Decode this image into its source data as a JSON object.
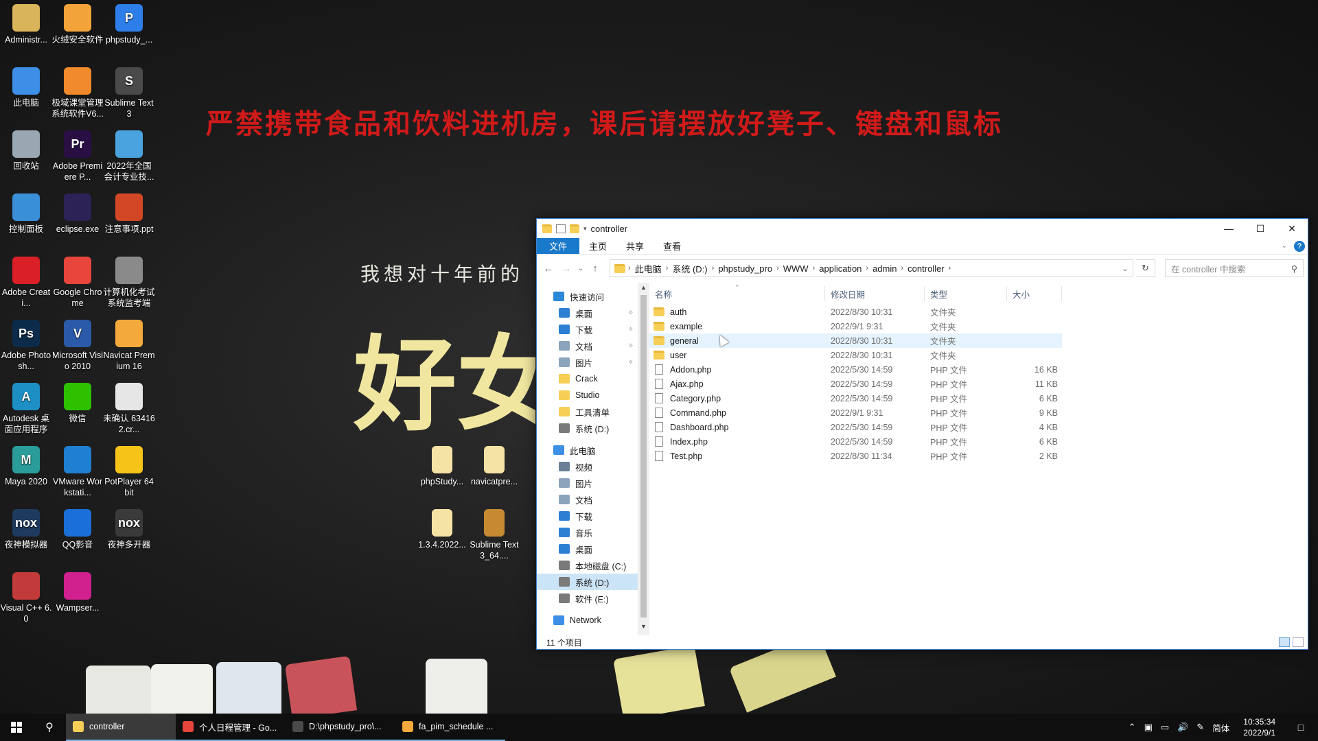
{
  "wallpaper": {
    "banner": "严禁携带食品和饮料进机房，课后请摆放好凳子、键盘和鼠标",
    "phrase": "我想对十年前的",
    "big_text": "好女"
  },
  "desktop_icons": [
    {
      "label": "Administr...",
      "icon": "user-folder-icon",
      "color": "#d9b45a"
    },
    {
      "label": "火绒安全软件",
      "icon": "huorong-icon",
      "color": "#f2a33a"
    },
    {
      "label": "phpstudy_...",
      "icon": "phpstudy-icon",
      "color": "#2d7ee8",
      "glyph": "P"
    },
    {
      "label": "此电脑",
      "icon": "computer-icon",
      "color": "#3c8ee6"
    },
    {
      "label": "极域课堂管理系统软件V6...",
      "icon": "classroom-icon",
      "color": "#f08a2c"
    },
    {
      "label": "Sublime Text3",
      "icon": "sublime-icon",
      "color": "#4a4a4a",
      "glyph": "S"
    },
    {
      "label": "回收站",
      "icon": "recycle-bin-icon",
      "color": "#9aa7b3"
    },
    {
      "label": "Adobe Premiere P...",
      "icon": "premiere-icon",
      "color": "#2a0f45",
      "glyph": "Pr"
    },
    {
      "label": "2022年全国会计专业技...",
      "icon": "mp3-file-icon",
      "color": "#4aa3df"
    },
    {
      "label": "控制面板",
      "icon": "control-panel-icon",
      "color": "#3a8fd9"
    },
    {
      "label": "eclipse.exe",
      "icon": "eclipse-icon",
      "color": "#2c2255"
    },
    {
      "label": "注意事项.ppt",
      "icon": "ppt-file-icon",
      "color": "#d24726"
    },
    {
      "label": "Adobe Creati...",
      "icon": "creative-cloud-icon",
      "color": "#da1f26"
    },
    {
      "label": "Google Chrome",
      "icon": "chrome-icon",
      "color": "#e8453c"
    },
    {
      "label": "计算机化考试系统监考端",
      "icon": "exam-icon",
      "color": "#8a8a8a"
    },
    {
      "label": "Adobe Photosh...",
      "icon": "photoshop-icon",
      "color": "#0c2b4a",
      "glyph": "Ps"
    },
    {
      "label": "Microsoft Visio 2010",
      "icon": "visio-icon",
      "color": "#2a5aa8",
      "glyph": "V"
    },
    {
      "label": "Navicat Premium 16",
      "icon": "navicat-icon",
      "color": "#f3a93b"
    },
    {
      "label": "Autodesk 桌面应用程序",
      "icon": "autodesk-icon",
      "color": "#1d8fc4",
      "glyph": "A"
    },
    {
      "label": "微信",
      "icon": "wechat-icon",
      "color": "#2dc100"
    },
    {
      "label": "未确认 634162.cr...",
      "icon": "file-icon",
      "color": "#e6e6e6"
    },
    {
      "label": "Maya 2020",
      "icon": "maya-icon",
      "color": "#2a9d9a",
      "glyph": "M"
    },
    {
      "label": "VMware Workstati...",
      "icon": "vmware-icon",
      "color": "#1f7fd1"
    },
    {
      "label": "PotPlayer 64 bit",
      "icon": "potplayer-icon",
      "color": "#f6c419"
    },
    {
      "label": "夜神模拟器",
      "icon": "nox-icon",
      "color": "#1e3a5f",
      "glyph": "nox"
    },
    {
      "label": "QQ影音",
      "icon": "qqplayer-icon",
      "color": "#1a6fd8"
    },
    {
      "label": "夜神多开器",
      "icon": "nox-multi-icon",
      "color": "#3a3a3a",
      "glyph": "nox"
    },
    {
      "label": "Visual C++ 6.0",
      "icon": "visual-cpp-icon",
      "color": "#c23a3a"
    },
    {
      "label": "Wampser...",
      "icon": "wampserver-icon",
      "color": "#d0218f"
    }
  ],
  "desktop_files": [
    {
      "label": "phpStudy...",
      "icon": "folder-icon"
    },
    {
      "label": "navicatpre...",
      "icon": "folder-icon"
    },
    {
      "label": "1.3.4.2022...",
      "icon": "folder-icon"
    },
    {
      "label": "Sublime Text3_64....",
      "icon": "archive-icon"
    }
  ],
  "explorer": {
    "title": "controller",
    "ribbon_tabs": [
      "文件",
      "主页",
      "共享",
      "查看"
    ],
    "help": "?",
    "breadcrumb": [
      "此电脑",
      "系统 (D:)",
      "phpstudy_pro",
      "WWW",
      "application",
      "admin",
      "controller"
    ],
    "search_placeholder": "在 controller 中搜索",
    "nav": [
      {
        "label": "快速访问",
        "level": 0,
        "color": "#2b88d8"
      },
      {
        "label": "桌面",
        "level": 1,
        "color": "#2d7fd3",
        "pinned": true
      },
      {
        "label": "下载",
        "level": 1,
        "color": "#2d7fd3",
        "pinned": true
      },
      {
        "label": "文档",
        "level": 1,
        "color": "#8ba3bb",
        "pinned": true
      },
      {
        "label": "图片",
        "level": 1,
        "color": "#8ba3bb",
        "pinned": true
      },
      {
        "label": "Crack",
        "level": 1,
        "color": "#f7cf57"
      },
      {
        "label": "Studio",
        "level": 1,
        "color": "#f7cf57"
      },
      {
        "label": "工具清单",
        "level": 1,
        "color": "#f7cf57"
      },
      {
        "label": "系统 (D:)",
        "level": 1,
        "color": "#7a7a7a"
      },
      {
        "gap": true
      },
      {
        "label": "此电脑",
        "level": 0,
        "color": "#3c8ee6"
      },
      {
        "label": "视频",
        "level": 1,
        "color": "#6a7f95"
      },
      {
        "label": "图片",
        "level": 1,
        "color": "#8ba3bb"
      },
      {
        "label": "文档",
        "level": 1,
        "color": "#8ba3bb"
      },
      {
        "label": "下载",
        "level": 1,
        "color": "#2d7fd3"
      },
      {
        "label": "音乐",
        "level": 1,
        "color": "#2d7fd3"
      },
      {
        "label": "桌面",
        "level": 1,
        "color": "#2d7fd3"
      },
      {
        "label": "本地磁盘 (C:)",
        "level": 1,
        "color": "#7a7a7a"
      },
      {
        "label": "系统 (D:)",
        "level": 1,
        "color": "#7a7a7a",
        "selected": true
      },
      {
        "label": "软件 (E:)",
        "level": 1,
        "color": "#7a7a7a"
      },
      {
        "gap": true
      },
      {
        "label": "Network",
        "level": 0,
        "color": "#3c8ee6"
      }
    ],
    "columns": {
      "name": "名称",
      "date": "修改日期",
      "type": "类型",
      "size": "大小"
    },
    "files": [
      {
        "name": "auth",
        "date": "2022/8/30 10:31",
        "type": "文件夹",
        "size": "",
        "kind": "folder"
      },
      {
        "name": "example",
        "date": "2022/9/1 9:31",
        "type": "文件夹",
        "size": "",
        "kind": "folder"
      },
      {
        "name": "general",
        "date": "2022/8/30 10:31",
        "type": "文件夹",
        "size": "",
        "kind": "folder",
        "hover": true
      },
      {
        "name": "user",
        "date": "2022/8/30 10:31",
        "type": "文件夹",
        "size": "",
        "kind": "folder"
      },
      {
        "name": "Addon.php",
        "date": "2022/5/30 14:59",
        "type": "PHP 文件",
        "size": "16 KB",
        "kind": "file"
      },
      {
        "name": "Ajax.php",
        "date": "2022/5/30 14:59",
        "type": "PHP 文件",
        "size": "11 KB",
        "kind": "file"
      },
      {
        "name": "Category.php",
        "date": "2022/5/30 14:59",
        "type": "PHP 文件",
        "size": "6 KB",
        "kind": "file"
      },
      {
        "name": "Command.php",
        "date": "2022/9/1 9:31",
        "type": "PHP 文件",
        "size": "9 KB",
        "kind": "file"
      },
      {
        "name": "Dashboard.php",
        "date": "2022/5/30 14:59",
        "type": "PHP 文件",
        "size": "4 KB",
        "kind": "file"
      },
      {
        "name": "Index.php",
        "date": "2022/5/30 14:59",
        "type": "PHP 文件",
        "size": "6 KB",
        "kind": "file"
      },
      {
        "name": "Test.php",
        "date": "2022/8/30 11:34",
        "type": "PHP 文件",
        "size": "2 KB",
        "kind": "file"
      }
    ],
    "status": "11 个项目"
  },
  "taskbar": {
    "tasks": [
      {
        "label": "controller",
        "icon": "folder-icon",
        "color": "#f7cf57",
        "active": true
      },
      {
        "label": "个人日程管理 - Go...",
        "icon": "chrome-icon",
        "color": "#e8453c"
      },
      {
        "label": "D:\\phpstudy_pro\\...",
        "icon": "sublime-icon",
        "color": "#4a4a4a"
      },
      {
        "label": "fa_pim_schedule ...",
        "icon": "navicat-icon",
        "color": "#f3a93b"
      }
    ],
    "ime": "简体",
    "time": "10:35:34",
    "date": "2022/9/1"
  }
}
